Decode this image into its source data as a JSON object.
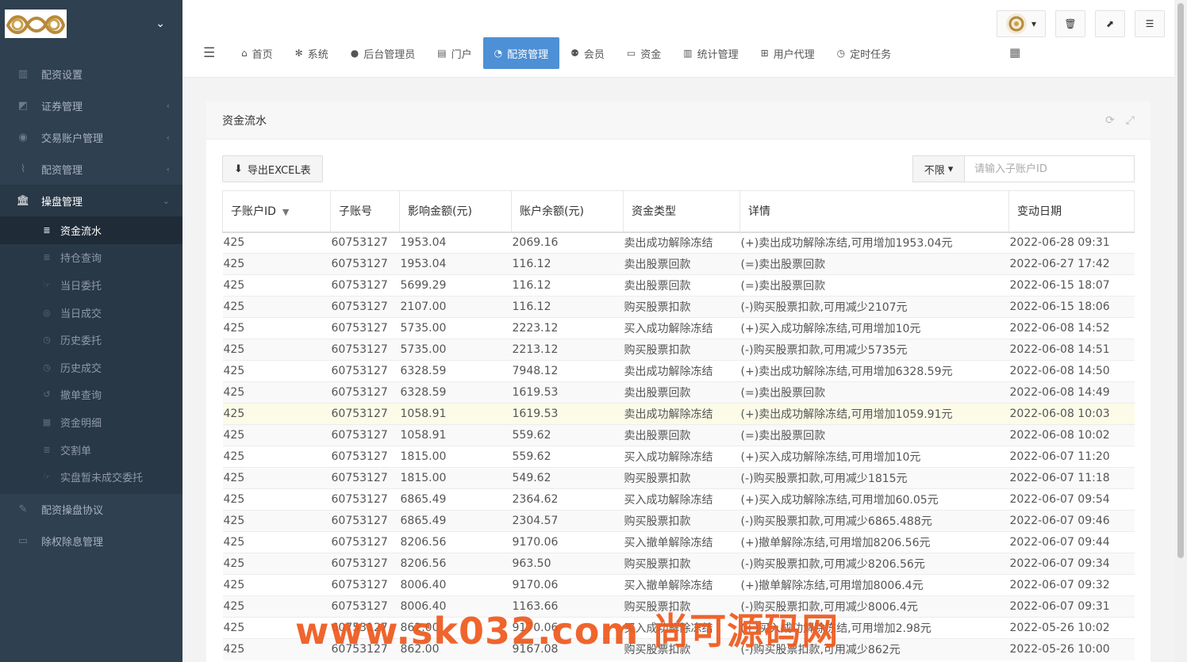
{
  "sidebar": {
    "menu": [
      {
        "icon": "bar-chart-icon",
        "label": "配资设置",
        "arrow": ""
      },
      {
        "icon": "area-chart-icon",
        "label": "证券管理",
        "arrow": "‹"
      },
      {
        "icon": "user-circle-icon",
        "label": "交易账户管理",
        "arrow": "‹"
      },
      {
        "icon": "paperclip-icon",
        "label": "配资管理",
        "arrow": "‹"
      },
      {
        "icon": "bank-icon",
        "label": "操盘管理",
        "arrow": "⌄"
      }
    ],
    "submenu": [
      {
        "icon": "list-icon",
        "label": "资金流水"
      },
      {
        "icon": "list-icon",
        "label": "持仓查询"
      },
      {
        "icon": "hand-icon",
        "label": "当日委托"
      },
      {
        "icon": "eye-icon",
        "label": "当日成交"
      },
      {
        "icon": "clock-icon",
        "label": "历史委托"
      },
      {
        "icon": "clock-icon",
        "label": "历史成交"
      },
      {
        "icon": "undo-icon",
        "label": "撤单查询"
      },
      {
        "icon": "table-icon",
        "label": "资金明细"
      },
      {
        "icon": "list-icon",
        "label": "交割单"
      },
      {
        "icon": "hand-icon",
        "label": "实盘暂未成交委托"
      }
    ],
    "menu_bottom": [
      {
        "icon": "pencil-icon",
        "label": "配资操盘协议"
      },
      {
        "icon": "money-icon",
        "label": "除权除息管理"
      }
    ]
  },
  "tabs": [
    {
      "icon": "home-icon",
      "label": "首页"
    },
    {
      "icon": "cog-icon",
      "label": "系统"
    },
    {
      "icon": "user-icon",
      "label": "后台管理员"
    },
    {
      "icon": "window-icon",
      "label": "门户"
    },
    {
      "icon": "pie-chart-icon",
      "label": "配资管理"
    },
    {
      "icon": "users-icon",
      "label": "会员"
    },
    {
      "icon": "money-icon",
      "label": "资金"
    },
    {
      "icon": "bar-chart-icon",
      "label": "统计管理"
    },
    {
      "icon": "sitemap-icon",
      "label": "用户代理"
    },
    {
      "icon": "clock-icon",
      "label": "定时任务"
    }
  ],
  "panel": {
    "title": "资金流水",
    "export_label": "导出EXCEL表",
    "filter_select": "不限",
    "filter_placeholder": "请输入子账户ID"
  },
  "table": {
    "headers": [
      "子账户ID",
      "子账号",
      "影响金额(元)",
      "账户余额(元)",
      "资金类型",
      "详情",
      "变动日期"
    ],
    "rows": [
      [
        "425",
        "60753127",
        "1953.04",
        "2069.16",
        "卖出成功解除冻结",
        "(+)卖出成功解除冻结,可用增加1953.04元",
        "2022-06-28 09:31"
      ],
      [
        "425",
        "60753127",
        "1953.04",
        "116.12",
        "卖出股票回款",
        "(=)卖出股票回款",
        "2022-06-27 17:42"
      ],
      [
        "425",
        "60753127",
        "5699.29",
        "116.12",
        "卖出股票回款",
        "(=)卖出股票回款",
        "2022-06-15 18:07"
      ],
      [
        "425",
        "60753127",
        "2107.00",
        "116.12",
        "购买股票扣款",
        "(-)购买股票扣款,可用减少2107元",
        "2022-06-15 18:06"
      ],
      [
        "425",
        "60753127",
        "5735.00",
        "2223.12",
        "买入成功解除冻结",
        "(+)买入成功解除冻结,可用增加10元",
        "2022-06-08 14:52"
      ],
      [
        "425",
        "60753127",
        "5735.00",
        "2213.12",
        "购买股票扣款",
        "(-)购买股票扣款,可用减少5735元",
        "2022-06-08 14:51"
      ],
      [
        "425",
        "60753127",
        "6328.59",
        "7948.12",
        "卖出成功解除冻结",
        "(+)卖出成功解除冻结,可用增加6328.59元",
        "2022-06-08 14:50"
      ],
      [
        "425",
        "60753127",
        "6328.59",
        "1619.53",
        "卖出股票回款",
        "(=)卖出股票回款",
        "2022-06-08 14:49"
      ],
      [
        "425",
        "60753127",
        "1058.91",
        "1619.53",
        "卖出成功解除冻结",
        "(+)卖出成功解除冻结,可用增加1059.91元",
        "2022-06-08 10:03"
      ],
      [
        "425",
        "60753127",
        "1058.91",
        "559.62",
        "卖出股票回款",
        "(=)卖出股票回款",
        "2022-06-08 10:02"
      ],
      [
        "425",
        "60753127",
        "1815.00",
        "559.62",
        "买入成功解除冻结",
        "(+)买入成功解除冻结,可用增加10元",
        "2022-06-07 11:20"
      ],
      [
        "425",
        "60753127",
        "1815.00",
        "549.62",
        "购买股票扣款",
        "(-)购买股票扣款,可用减少1815元",
        "2022-06-07 11:18"
      ],
      [
        "425",
        "60753127",
        "6865.49",
        "2364.62",
        "买入成功解除冻结",
        "(+)买入成功解除冻结,可用增加60.05元",
        "2022-06-07 09:54"
      ],
      [
        "425",
        "60753127",
        "6865.49",
        "2304.57",
        "购买股票扣款",
        "(-)购买股票扣款,可用减少6865.488元",
        "2022-06-07 09:46"
      ],
      [
        "425",
        "60753127",
        "8206.56",
        "9170.06",
        "买入撤单解除冻结",
        "(+)撤单解除冻结,可用增加8206.56元",
        "2022-06-07 09:44"
      ],
      [
        "425",
        "60753127",
        "8206.56",
        "963.50",
        "购买股票扣款",
        "(-)购买股票扣款,可用减少8206.56元",
        "2022-06-07 09:34"
      ],
      [
        "425",
        "60753127",
        "8006.40",
        "9170.06",
        "买入撤单解除冻结",
        "(+)撤单解除冻结,可用增加8006.4元",
        "2022-06-07 09:32"
      ],
      [
        "425",
        "60753127",
        "8006.40",
        "1163.66",
        "购买股票扣款",
        "(-)购买股票扣款,可用减少8006.4元",
        "2022-06-07 09:31"
      ],
      [
        "425",
        "60753127",
        "862.00",
        "9170.06",
        "买入成功解除冻结",
        "(+)买入成功解除冻结,可用增加2.98元",
        "2022-05-26 10:02"
      ],
      [
        "425",
        "60753127",
        "862.00",
        "9167.08",
        "购买股票扣款",
        "(-)购买股票扣款,可用减少862元",
        "2022-05-26 10:00"
      ]
    ]
  },
  "watermark": "www.sk032.com 尚可源码网",
  "colors": {
    "sidebar": "#2f4050",
    "accent": "#4e90d5",
    "watermark": "#ee5a1e"
  }
}
